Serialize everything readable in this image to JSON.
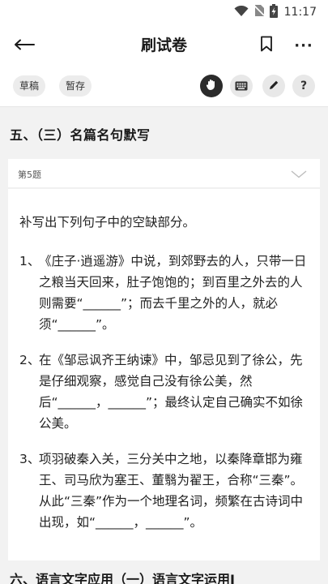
{
  "status_bar": {
    "time": "11:17",
    "icons": [
      "wifi-icon",
      "no-sim-icon",
      "battery-charging-icon"
    ]
  },
  "app_bar": {
    "title": "刷试卷",
    "icons": [
      "back-arrow-icon",
      "bookmark-icon",
      "more-icon"
    ],
    "more_label": "···"
  },
  "toolbar": {
    "draft_label": "草稿",
    "save_label": "暂存",
    "icons": [
      "hand-icon",
      "keyboard-icon",
      "pencil-icon",
      "help-icon"
    ],
    "help_label": "?"
  },
  "section": {
    "title": "五、（三）名篇名句默写"
  },
  "question": {
    "number_label": "第5题",
    "collapse_icon": "chevron-down-icon",
    "prompt": "补写出下列句子中的空缺部分。",
    "items": [
      {
        "num": "1、",
        "text": "《庄子·逍遥游》中说，到郊野去的人，只带一日之粮当天回来，肚子饱饱的；到百里之外去的人则需要“______”；而去千里之外的人，就必须“______”。"
      },
      {
        "num": "2、",
        "text": "在《邹忌讽齐王纳谏》中，邹忌见到了徐公，先是仔细观察，感觉自己没有徐公美，然后“______，______”；最终认定自己确实不如徐公美。"
      },
      {
        "num": "3、",
        "text": "项羽破秦入关，三分关中之地，以秦降章邯为雍王、司马欣为塞王、董翳为翟王，合称“三秦”。从此“三秦”作为一个地理名词，频繁在古诗词中出现，如“______，______”。"
      }
    ]
  },
  "next_section": {
    "title": "六、语言文字应用（一）语言文字运用Ⅰ"
  },
  "colors": {
    "background": "#f2f2f2",
    "card": "#ffffff",
    "text": "#222222",
    "active_button": "#2b2b2b"
  }
}
